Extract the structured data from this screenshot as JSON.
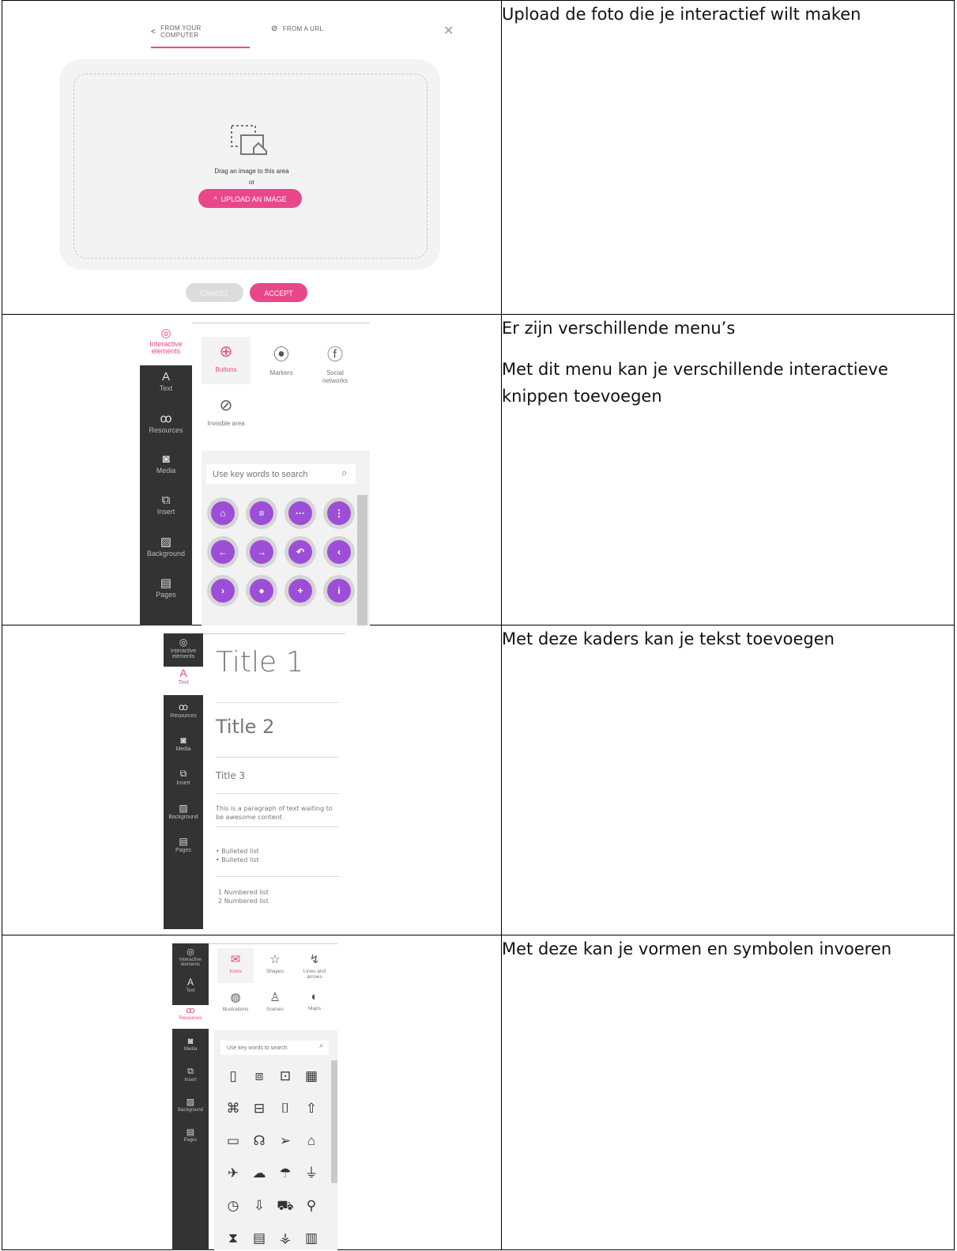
{
  "rows": [
    {
      "caption": [
        "Upload de foto die je interactief wilt maken"
      ],
      "upload": {
        "tab_computer": "FROM YOUR\nCOMPUTER",
        "tab_url": "FROM A URL",
        "drag_text": "Drag an image to this area",
        "or_text": "or",
        "upload_button": "UPLOAD AN IMAGE",
        "cancel_button": "CANCEL",
        "accept_button": "ACCEPT"
      }
    },
    {
      "caption": [
        "Er zijn verschillende menu’s",
        "Met dit menu kan je verschillende interactieve knippen toevoegen"
      ],
      "cards": [
        "Buttons",
        "Markers",
        "Social\nnetworks",
        "Invisible area"
      ],
      "search_placeholder": "Use key words to search"
    },
    {
      "caption": [
        "Met deze kaders kan je tekst toevoegen"
      ],
      "styles": {
        "title1": "Title 1",
        "title2": "Title 2",
        "title3": "Title 3",
        "paragraph": "This is a paragraph of text waiting to be awesome content",
        "bullet1": "•  Bulleted list",
        "bullet2": "•  Bulleted list",
        "num1": "1 Numbered list",
        "num2": "2 Numbered list"
      }
    },
    {
      "caption": [
        "Met deze kan je vormen en symbolen invoeren"
      ],
      "cards": [
        "Icons",
        "Shapes",
        "Lines and\narrows",
        "Illustrations",
        "Scenes",
        "Maps"
      ],
      "search_placeholder": "Use key words to search"
    }
  ],
  "sidebar": {
    "interactive": "Interactive\nelements",
    "text": "Text",
    "resources": "Resources",
    "media": "Media",
    "insert": "Insert",
    "background": "Background",
    "pages": "Pages"
  },
  "colors": {
    "accent": "#e8488a",
    "button_purple": "#9c4fd6",
    "sidebar": "#333333"
  }
}
